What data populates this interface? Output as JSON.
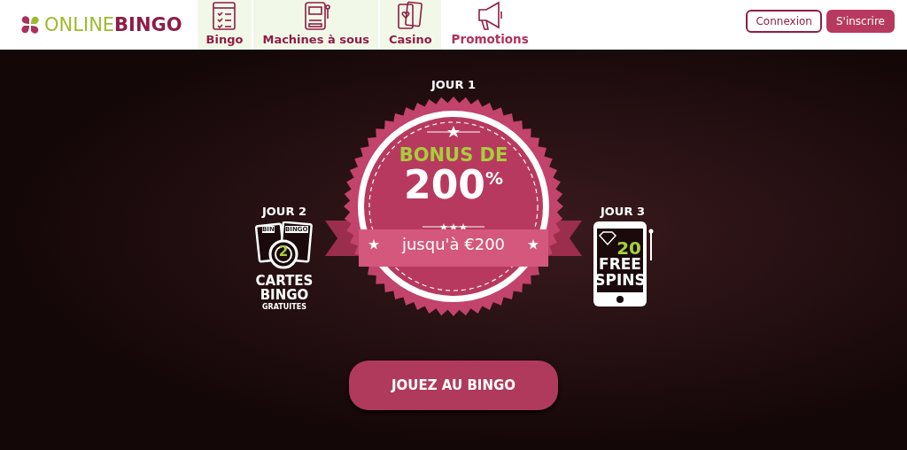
{
  "header": {
    "logo": {
      "light": "ONLINE",
      "bold": "BINGO"
    },
    "nav": [
      {
        "label": "Bingo",
        "kind": "category"
      },
      {
        "label": "Machines à sous",
        "kind": "category"
      },
      {
        "label": "Casino",
        "kind": "category"
      },
      {
        "label": "Promotions",
        "kind": "promo"
      }
    ],
    "buttons": [
      {
        "label": "Connexion",
        "kind": "outline"
      },
      {
        "label": "S'inscrire",
        "kind": "filled"
      }
    ]
  },
  "hero": {
    "day1": {
      "title": "JOUR 1",
      "headline": "BONUS DE",
      "amount": "200$^{%}$",
      "ribbon": "jusqu'à €200"
    },
    "day2": {
      "title": "JOUR 2",
      "card_labels": [
        "BIN",
        "BINGO"
      ],
      "count": "2",
      "lines": [
        "CARTES",
        "BINGO"
      ],
      "small": "GRATUITES"
    },
    "day3": {
      "title": "JOUR 3",
      "count": "20",
      "lines": [
        "FREE",
        "SPINS"
      ]
    },
    "cta": "JOUEZ AU BINGO"
  }
}
